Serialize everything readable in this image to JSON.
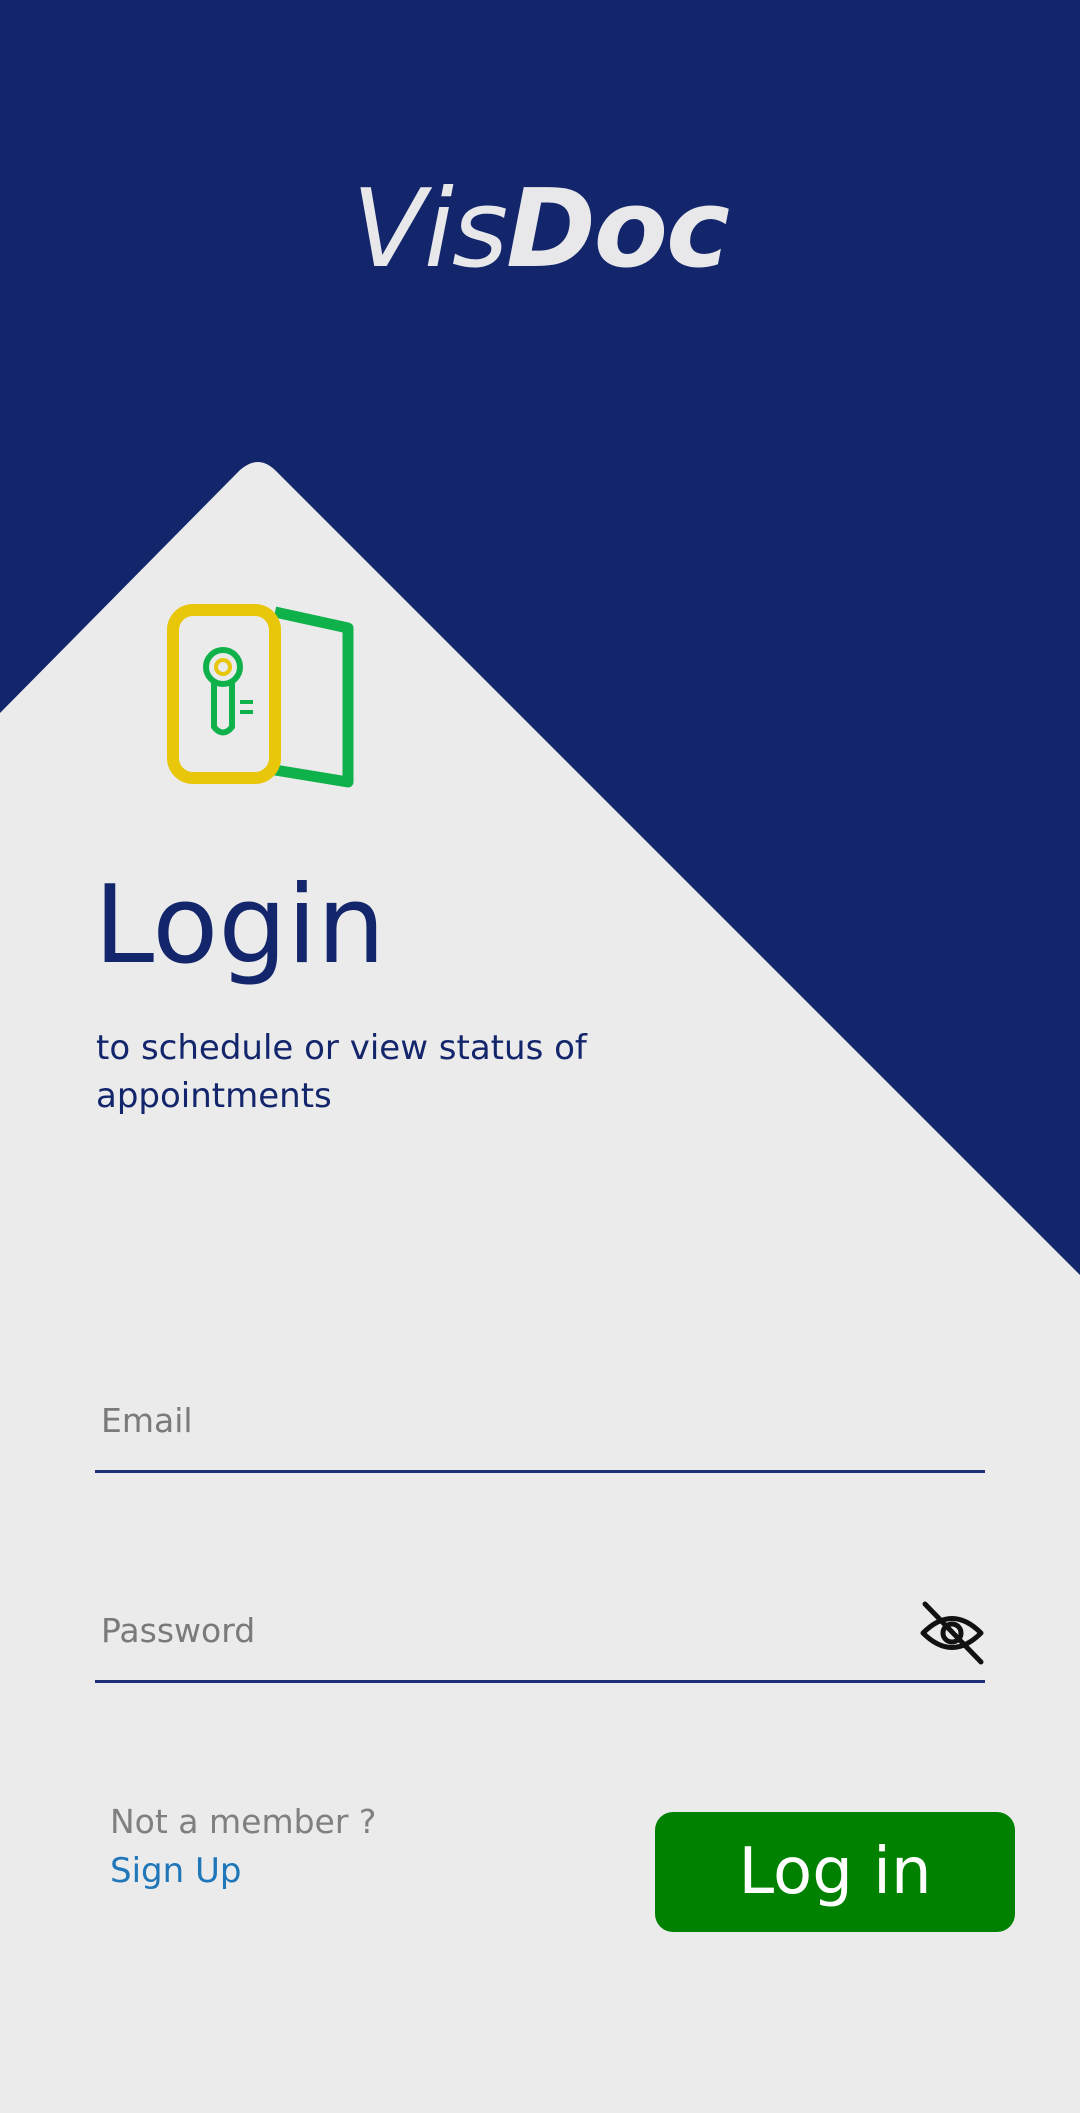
{
  "colors": {
    "navy": "#13266b",
    "card_bg": "#ebebeb",
    "button_green": "#008200",
    "link_blue": "#1f76b9",
    "icon_yellow": "#e8c60a",
    "icon_green": "#0fb14b"
  },
  "brand": {
    "part1": "Vis",
    "part2": "Doc"
  },
  "hero": {
    "icon": "door-key-icon",
    "title": "Login",
    "subtitle": "to schedule or view status of appointments"
  },
  "form": {
    "email": {
      "placeholder": "Email",
      "value": ""
    },
    "password": {
      "placeholder": "Password",
      "value": "",
      "toggle_icon": "eye-off-icon"
    },
    "not_member_text": "Not a member ?",
    "signup_label": "Sign Up",
    "submit_label": "Log in"
  }
}
